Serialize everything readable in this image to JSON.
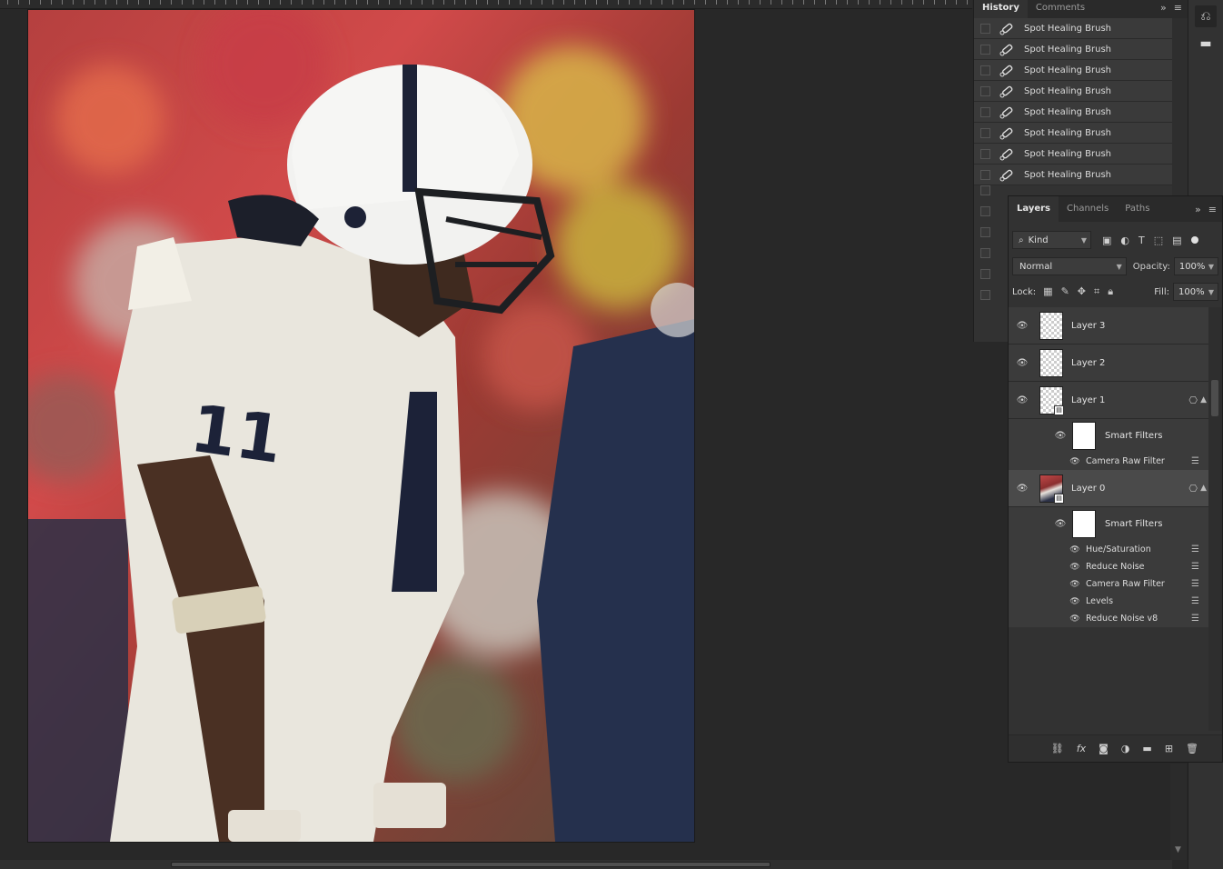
{
  "colors": {
    "panel_bg": "#323232",
    "workspace_bg": "#282828",
    "selected_row": "#4a4a4a"
  },
  "history": {
    "tabs": [
      {
        "label": "History",
        "active": true
      },
      {
        "label": "Comments",
        "active": false
      }
    ],
    "items": [
      "Spot Healing Brush",
      "Spot Healing Brush",
      "Spot Healing Brush",
      "Spot Healing Brush",
      "Spot Healing Brush",
      "Spot Healing Brush",
      "Spot Healing Brush",
      "Spot Healing Brush"
    ]
  },
  "layers": {
    "tabs": [
      {
        "label": "Layers",
        "active": true
      },
      {
        "label": "Channels",
        "active": false
      },
      {
        "label": "Paths",
        "active": false
      }
    ],
    "filter_kind": "Kind",
    "blend_mode": "Normal",
    "opacity_label": "Opacity:",
    "opacity": "100%",
    "lock_label": "Lock:",
    "fill_label": "Fill:",
    "fill": "100%",
    "rows": {
      "layer3": "Layer 3",
      "layer2": "Layer 2",
      "layer1": "Layer 1",
      "layer1_smart_filters": "Smart Filters",
      "layer1_filters": [
        "Camera Raw Filter"
      ],
      "layer0": "Layer 0",
      "layer0_smart_filters": "Smart Filters",
      "layer0_filters": [
        "Hue/Saturation",
        "Reduce Noise",
        "Camera Raw Filter",
        "Levels",
        "Reduce Noise v8"
      ]
    }
  },
  "icons": {
    "eye": "eye-icon",
    "brush": "spot-healing-brush-icon",
    "search": "search-icon",
    "link": "link-icon",
    "fx": "fx-icon",
    "mask": "mask-icon",
    "adjustment": "adjustment-icon",
    "folder": "folder-icon",
    "new_layer": "new-layer-icon",
    "trash": "trash-icon"
  }
}
